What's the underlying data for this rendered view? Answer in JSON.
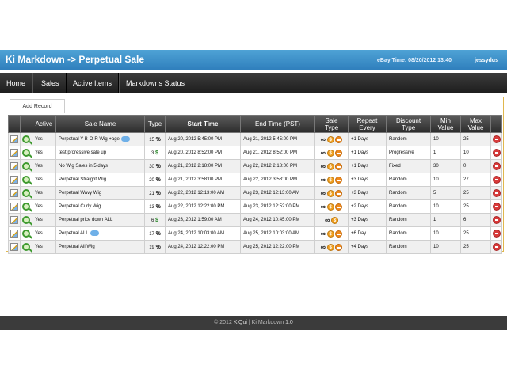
{
  "header": {
    "title": "Ki Markdown -> Perpetual Sale",
    "ebay_time": "eBay Time: 08/20/2012 13:40",
    "username": "jessydus"
  },
  "nav": [
    "Home",
    "Sales",
    "Active Items",
    "Markdowns Status"
  ],
  "toolbar": {
    "add_record_label": "Add Record"
  },
  "table": {
    "headers": [
      "Active",
      "Sale Name",
      "Type",
      "Start Time",
      "End Time (PST)",
      "Sale\nType",
      "Repeat\nEvery",
      "Discount\nType",
      "Min\nValue",
      "Max\nValue"
    ],
    "rows": [
      {
        "active": "Yes",
        "name": "Perpetual Y-B-O-R Wig +age",
        "comment": true,
        "type_num": "15",
        "type_sym": "%",
        "start": "Aug 20, 2012 5:45:00 PM",
        "end": "Aug 21, 2012 5:45:00 PM",
        "sale_icons": "inf-coin-arrow",
        "repeat": "+1 Days",
        "discount": "Random",
        "min": "10",
        "max": "25"
      },
      {
        "active": "Yes",
        "name": "test proressive sale up",
        "comment": false,
        "type_num": "3",
        "type_sym": "$",
        "start": "Aug 20, 2012 8:52:00 PM",
        "end": "Aug 21, 2012 8:52:00 PM",
        "sale_icons": "inf-coin-arrow",
        "repeat": "+1 Days",
        "discount": "Progressive",
        "min": "1",
        "max": "10"
      },
      {
        "active": "Yes",
        "name": "No Wig Sales in 5 days",
        "comment": false,
        "type_num": "30",
        "type_sym": "%",
        "start": "Aug 21, 2012 2:18:00 PM",
        "end": "Aug 22, 2012 2:18:00 PM",
        "sale_icons": "inf-coin-arrow",
        "repeat": "+1 Days",
        "discount": "Fixed",
        "min": "30",
        "max": "0"
      },
      {
        "active": "Yes",
        "name": "Perpetual Straight Wig",
        "comment": false,
        "type_num": "20",
        "type_sym": "%",
        "start": "Aug 21, 2012 3:58:00 PM",
        "end": "Aug 22, 2012 3:58:00 PM",
        "sale_icons": "inf-coin-arrow",
        "repeat": "+3 Days",
        "discount": "Random",
        "min": "10",
        "max": "27"
      },
      {
        "active": "Yes",
        "name": "Perpetual Wavy Wig",
        "comment": false,
        "type_num": "21",
        "type_sym": "%",
        "start": "Aug 22, 2012 12:13:00 AM",
        "end": "Aug 23, 2012 12:13:00 AM",
        "sale_icons": "inf-coin-arrow",
        "repeat": "+3 Days",
        "discount": "Random",
        "min": "5",
        "max": "25"
      },
      {
        "active": "Yes",
        "name": "Perpetual Curly Wig",
        "comment": false,
        "type_num": "13",
        "type_sym": "%",
        "start": "Aug 22, 2012 12:22:00 PM",
        "end": "Aug 23, 2012 12:52:00 PM",
        "sale_icons": "inf-coin-arrow",
        "repeat": "+2 Days",
        "discount": "Random",
        "min": "10",
        "max": "25"
      },
      {
        "active": "Yes",
        "name": "Perpetual price down ALL",
        "comment": false,
        "type_num": "6",
        "type_sym": "$",
        "start": "Aug 23, 2012 1:59:00 AM",
        "end": "Aug 24, 2012 10:45:00 PM",
        "sale_icons": "inf-coin",
        "repeat": "+3 Days",
        "discount": "Random",
        "min": "1",
        "max": "6"
      },
      {
        "active": "Yes",
        "name": "Perpetual ALL",
        "comment": true,
        "type_num": "17",
        "type_sym": "%",
        "start": "Aug 24, 2012 10:03:00 AM",
        "end": "Aug 25, 2012 10:03:00 AM",
        "sale_icons": "inf-coin-arrow",
        "repeat": "+6 Day",
        "discount": "Random",
        "min": "10",
        "max": "25"
      },
      {
        "active": "Yes",
        "name": "Perpetual All Wig",
        "comment": false,
        "type_num": "19",
        "type_sym": "%",
        "start": "Aug 24, 2012 12:22:00 PM",
        "end": "Aug 25, 2012 12:22:00 PM",
        "sale_icons": "inf-coin-arrow",
        "repeat": "+4 Days",
        "discount": "Random",
        "min": "10",
        "max": "25"
      }
    ]
  },
  "footer": {
    "copyright": "© 2012",
    "company_link": "KiQui",
    "separator": "|",
    "product": "Ki Markdown",
    "version_link": "1.0"
  },
  "icons": {
    "edit": "edit-icon",
    "view": "magnifier-icon",
    "delete": "delete-icon",
    "infinity": "infinity-icon",
    "coin": "coin-icon",
    "arrow": "arrow-icon",
    "comment": "comment-icon"
  },
  "colors": {
    "header_blue": "#2f7fbd",
    "nav_dark": "#2c2c2c",
    "content_border": "#e0b74d",
    "dollar_green": "#2d8a2d",
    "delete_red": "#d83b3b"
  }
}
